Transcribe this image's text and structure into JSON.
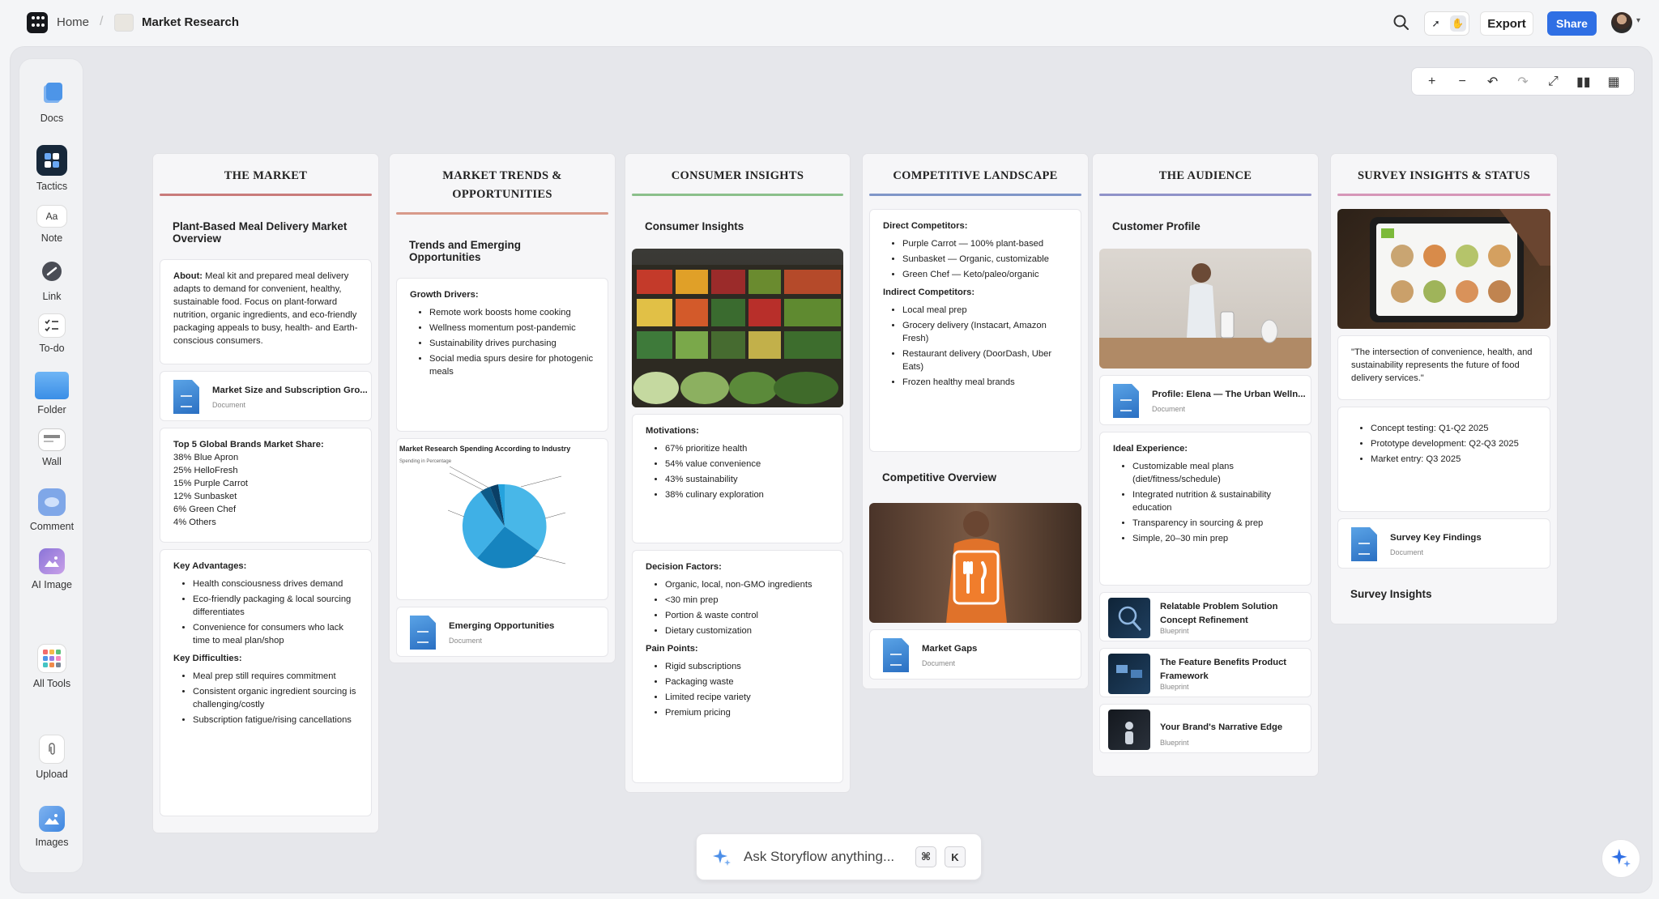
{
  "header": {
    "home": "Home",
    "separator": "/",
    "title": "Market Research",
    "export": "Export",
    "share": "Share"
  },
  "sidebar": {
    "docs": "Docs",
    "tactics": "Tactics",
    "note": "Note",
    "note_icon_text": "Aa",
    "link": "Link",
    "todo": "To-do",
    "folder": "Folder",
    "wall": "Wall",
    "comment": "Comment",
    "ai_image": "AI Image",
    "all_tools": "All Tools",
    "upload": "Upload",
    "images": "Images"
  },
  "ask": {
    "placeholder": "Ask Storyflow anything...",
    "key1": "⌘",
    "key2": "K"
  },
  "columns": {
    "market": {
      "title": "THE MARKET",
      "heading": "Plant-Based Meal Delivery Market Overview",
      "about_label": "About:",
      "about_text": "Meal kit and prepared meal delivery adapts to demand for convenient, healthy, sustainable food. Focus on plant-forward nutrition, organic ingredients, and eco-friendly packaging appeals to busy, health- and Earth-conscious consumers.",
      "doc_title": "Market Size and Subscription Gro...",
      "doc_sub": "Document",
      "share_label": "Top 5 Global Brands Market Share:",
      "share_lines": [
        "38% Blue Apron",
        "25% HelloFresh",
        "15% Purple Carrot",
        "12% Sunbasket",
        "6% Green Chef",
        "4% Others"
      ],
      "adv_label": "Key Advantages:",
      "adv": [
        "Health consciousness drives demand",
        "Eco-friendly packaging & local sourcing differentiates",
        "Convenience for consumers who lack time to meal plan/shop"
      ],
      "diff_label": "Key Difficulties:",
      "diff": [
        "Meal prep still requires commitment",
        "Consistent organic ingredient sourcing is challenging/costly",
        "Subscription fatigue/rising cancellations"
      ]
    },
    "trends": {
      "title_line1": "MARKET TRENDS &",
      "title_line2": "OPPORTUNITIES",
      "heading": "Trends and Emerging Opportunities",
      "growth_label": "Growth Drivers:",
      "growth": [
        "Remote work boosts home cooking",
        "Wellness momentum post-pandemic",
        "Sustainability drives purchasing",
        "Social media spurs desire for photogenic meals"
      ],
      "chart_title": "Market Research Spending According to Industry",
      "chart_sub": "Spending in Percentage",
      "doc_title": "Emerging Opportunities",
      "doc_sub": "Document"
    },
    "consumer": {
      "title": "CONSUMER INSIGHTS",
      "heading": "Consumer Insights",
      "mot_label": "Motivations:",
      "mot": [
        "67% prioritize health",
        "54% value convenience",
        "43% sustainability",
        "38% culinary exploration"
      ],
      "dec_label": "Decision Factors:",
      "dec": [
        "Organic, local, non-GMO ingredients",
        "<30 min prep",
        "Portion & waste control",
        "Dietary customization"
      ],
      "pain_label": "Pain Points:",
      "pain": [
        "Rigid subscriptions",
        "Packaging waste",
        "Limited recipe variety",
        "Premium pricing"
      ]
    },
    "competitive": {
      "title": "COMPETITIVE LANDSCAPE",
      "direct_label": "Direct Competitors:",
      "direct": [
        "Purple Carrot — 100% plant-based",
        "Sunbasket — Organic, customizable",
        "Green Chef — Keto/paleo/organic"
      ],
      "indirect_label": "Indirect Competitors:",
      "indirect": [
        "Local meal prep",
        "Grocery delivery (Instacart, Amazon Fresh)",
        "Restaurant delivery (DoorDash, Uber Eats)",
        "Frozen healthy meal brands"
      ],
      "overview": "Competitive Overview",
      "doc_title": "Market Gaps",
      "doc_sub": "Document"
    },
    "audience": {
      "title": "THE AUDIENCE",
      "heading": "Customer Profile",
      "doc_title": "Profile: Elena — The Urban Welln...",
      "doc_sub": "Document",
      "ideal_label": "Ideal Experience:",
      "ideal": [
        "Customizable meal plans (diet/fitness/schedule)",
        "Integrated nutrition & sustainability education",
        "Transparency in sourcing & prep",
        "Simple, 20–30 min prep"
      ],
      "bp1": "Relatable Problem Solution Concept Refinement",
      "bp2": "The Feature Benefits Product Framework",
      "bp3": "Your Brand's Narrative Edge",
      "bp_sub": "Blueprint"
    },
    "survey": {
      "title": "SURVEY INSIGHTS & STATUS",
      "quote": "\"The intersection of convenience, health, and sustainability represents the future of food delivery services.\"",
      "status": [
        "Concept testing: Q1-Q2 2025",
        "Prototype development: Q2-Q3 2025",
        "Market entry: Q3 2025"
      ],
      "doc_title": "Survey Key Findings",
      "doc_sub": "Document",
      "footer": "Survey Insights"
    }
  },
  "colors": {
    "market": "#c97b7b",
    "trends": "#d89a8a",
    "consumer": "#8bbf8b",
    "competitive": "#7f96c8",
    "audience": "#8f92c9",
    "survey": "#d696b8",
    "accent": "#2f6fe4"
  }
}
